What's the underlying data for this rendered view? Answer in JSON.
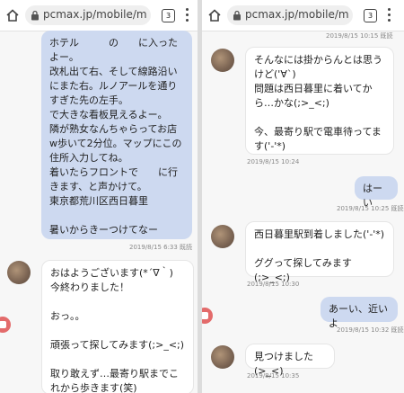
{
  "left": {
    "url": "pcmax.jp/mobile/mail_r",
    "tab_count": "3",
    "messages": [
      {
        "text": "ホテル　　　の　　に入ったよー。\n改札出て右、そして線路沿いにまた右。ルノアールを通りすぎた先の左手。　　　　　　で大きな看板見えるよー。\n隣が熟女なんちゃらってお店w歩いて2分位。マップにこの住所入力してね。\n着いたらフロントで　　に行きます、と声かけて。\n東京都荒川区西日暮里\n\n暑いからきーつけてなー",
        "meta": "2019/8/15 6:33 既読"
      },
      {
        "text": "おはようございます(*´∇｀)\n今終わりました！\n\nおっ。。\n\n頑張って探してみます(;>_<;)\n\n取り敢えず…最寄り駅までこれから歩きます(笑)"
      }
    ]
  },
  "right": {
    "url": "pcmax.jp/mobile/mail_r",
    "tab_count": "3",
    "top_meta": "2019/8/15 10:15 既読",
    "messages": [
      {
        "text": "そんなには掛からんとは思うけど('∀`)\n問題は西日暮里に着いてから…かな(;>_<;)\n\n今、最寄り駅で電車待ってます('-'*)",
        "meta": "2019/8/15 10:24"
      },
      {
        "text": "はーい",
        "meta": "2019/8/15 10:25 既読"
      },
      {
        "text": "西日暮里駅到着しました('-'*)\n\nググって探してみます(;>_<;)",
        "meta": "2019/8/15 10:30"
      },
      {
        "text": "あーい、近いよ",
        "meta": "2019/8/15 10:32 既読"
      },
      {
        "text": "見つけました(>_<)",
        "meta": "2019/8/15 10:35"
      }
    ]
  },
  "colors": {
    "outgoing": "#cdd9f0",
    "incoming": "#ffffff",
    "record_button": "#e36b6b"
  }
}
